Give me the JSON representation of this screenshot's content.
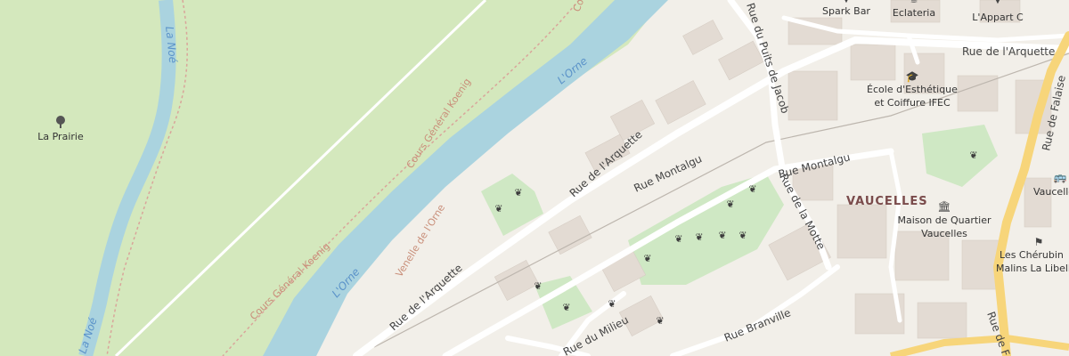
{
  "map": {
    "colors": {
      "land": "#f2efe9",
      "meadow": "#d4e8bd",
      "water": "#aad3df",
      "park": "#cfe8c4",
      "building": "#e3dbd3",
      "road": "#ffffff",
      "major_road": "#f7d57a",
      "footpath": "#d9a59a"
    },
    "water_labels": [
      "La Noé",
      "La Noé",
      "L'Orne",
      "L'Orne"
    ],
    "path_labels": [
      "Cours Général Koenig",
      "Cours Général Koenig",
      "Cours Général Koenig",
      "Venelle de l'Orne"
    ],
    "streets": [
      "Rue du Puits de Jacob",
      "Rue de l'Arquette",
      "Rue de l'Arquette",
      "Rue de l'Arquette",
      "Rue Montalgu",
      "Rue Montalgu",
      "Rue de la Motte",
      "Rue Branville",
      "Rue du Milieu",
      "Rue de Falaise",
      "Rue de F"
    ],
    "district": "VAUCELLES",
    "pois": [
      {
        "name": "La Prairie",
        "icon": "tree-icon"
      },
      {
        "name": "Spark Bar",
        "icon": "bar-icon"
      },
      {
        "name": "Eclateria",
        "icon": "cafe-icon"
      },
      {
        "name": "L'Appart C",
        "icon": "bar-icon"
      },
      {
        "name": "École d'Esthétique",
        "line2": "et Coiffure IFEC",
        "icon": "school-icon"
      },
      {
        "name": "Maison de Quartier",
        "line2": "Vaucelles",
        "icon": "townhall-icon"
      },
      {
        "name": "Vaucelles",
        "icon": "bus-icon"
      },
      {
        "name": "Les Chérubin",
        "line2": "Malins La Libelle",
        "icon": "nursery-icon"
      }
    ]
  }
}
